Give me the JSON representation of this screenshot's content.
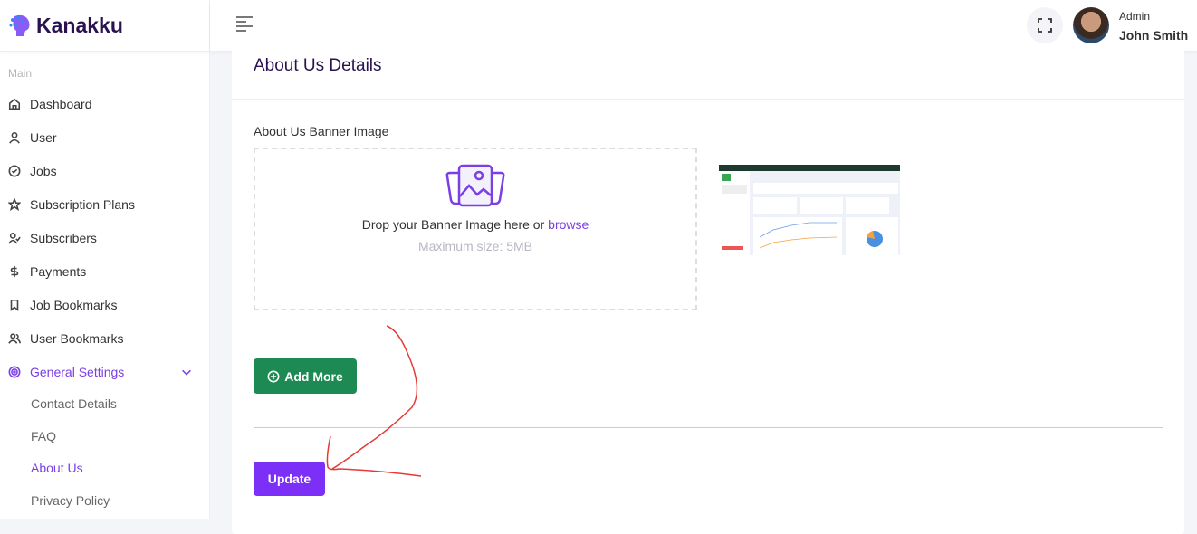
{
  "brand": {
    "name": "Kanakku"
  },
  "sidebar": {
    "section": "Main",
    "items": [
      {
        "label": "Dashboard",
        "icon": "home-icon"
      },
      {
        "label": "User",
        "icon": "user-icon"
      },
      {
        "label": "Jobs",
        "icon": "check-circle-icon"
      },
      {
        "label": "Subscription Plans",
        "icon": "star-icon"
      },
      {
        "label": "Subscribers",
        "icon": "user-check-icon"
      },
      {
        "label": "Payments",
        "icon": "dollar-icon"
      },
      {
        "label": "Job Bookmarks",
        "icon": "bookmark-icon"
      },
      {
        "label": "User Bookmarks",
        "icon": "users-icon"
      },
      {
        "label": "General Settings",
        "icon": "target-icon"
      }
    ],
    "sub_items": [
      {
        "label": "Contact Details"
      },
      {
        "label": "FAQ"
      },
      {
        "label": "About Us"
      },
      {
        "label": "Privacy Policy"
      }
    ]
  },
  "header": {
    "role": "Admin",
    "name": "John Smith"
  },
  "main": {
    "title": "About Us Details",
    "banner_label": "About Us Banner Image",
    "drop_text": "Drop your Banner Image here or ",
    "browse": "browse",
    "max_size": "Maximum size: 5MB",
    "add_more": "Add More",
    "update": "Update"
  },
  "colors": {
    "accent": "#7b2ff7",
    "green": "#1c8a52",
    "annotation": "#e53935"
  }
}
